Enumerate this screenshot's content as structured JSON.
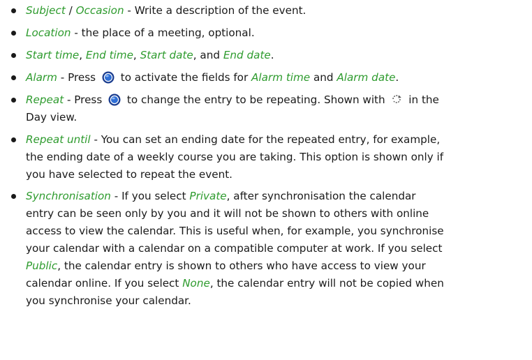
{
  "items": [
    {
      "term1": "Subject",
      "sep": " / ",
      "term2": "Occasion",
      "desc": " - Write a description of the event."
    },
    {
      "term1": "Location",
      "desc": " - the place of a meeting, optional."
    },
    {
      "terms": [
        "Start time",
        "End time",
        "Start date",
        "End date"
      ],
      "joins": [
        ", ",
        ", ",
        ", and ",
        "."
      ]
    },
    {
      "term1": "Alarm",
      "pre": " - Press ",
      "mid": " to activate the fields for ",
      "term2": "Alarm time",
      "and": " and ",
      "term3": "Alarm date",
      "end": "."
    },
    {
      "term1": "Repeat",
      "pre": " - Press ",
      "mid": " to change the entry to be repeating. Shown with ",
      "post": " in the",
      "line2": "Day view."
    },
    {
      "term1": "Repeat until",
      "desc_line1": " - You can set an ending date for the repeated entry, for example,",
      "desc_line2": "the ending date of a weekly course you are taking. This option is shown only if",
      "desc_line3": "you have selected to repeat the event."
    },
    {
      "term1": "Synchronisation",
      "l1a": " - If you select ",
      "term2": "Private",
      "l1b": ", after synchronisation the calendar",
      "l2": "entry can be seen only by you and it will not be shown to others with online",
      "l3": "access to view the calendar. This is useful when, for example, you synchronise",
      "l4": "your calendar with a calendar on a compatible computer at work. If you select",
      "term3": "Public",
      "l5": ", the calendar entry is shown to others who have access to view your",
      "l6a": "calendar online. If you select ",
      "term4": "None",
      "l6b": ", the calendar entry will not be copied when",
      "l7": "you synchronise your calendar."
    }
  ],
  "icons": {
    "select_key": "select-key-icon",
    "repeat": "repeat-icon"
  },
  "colors": {
    "term": "#2e9b2e",
    "key_outer": "#1b3d8f",
    "key_inner": "#2f6fd6"
  }
}
